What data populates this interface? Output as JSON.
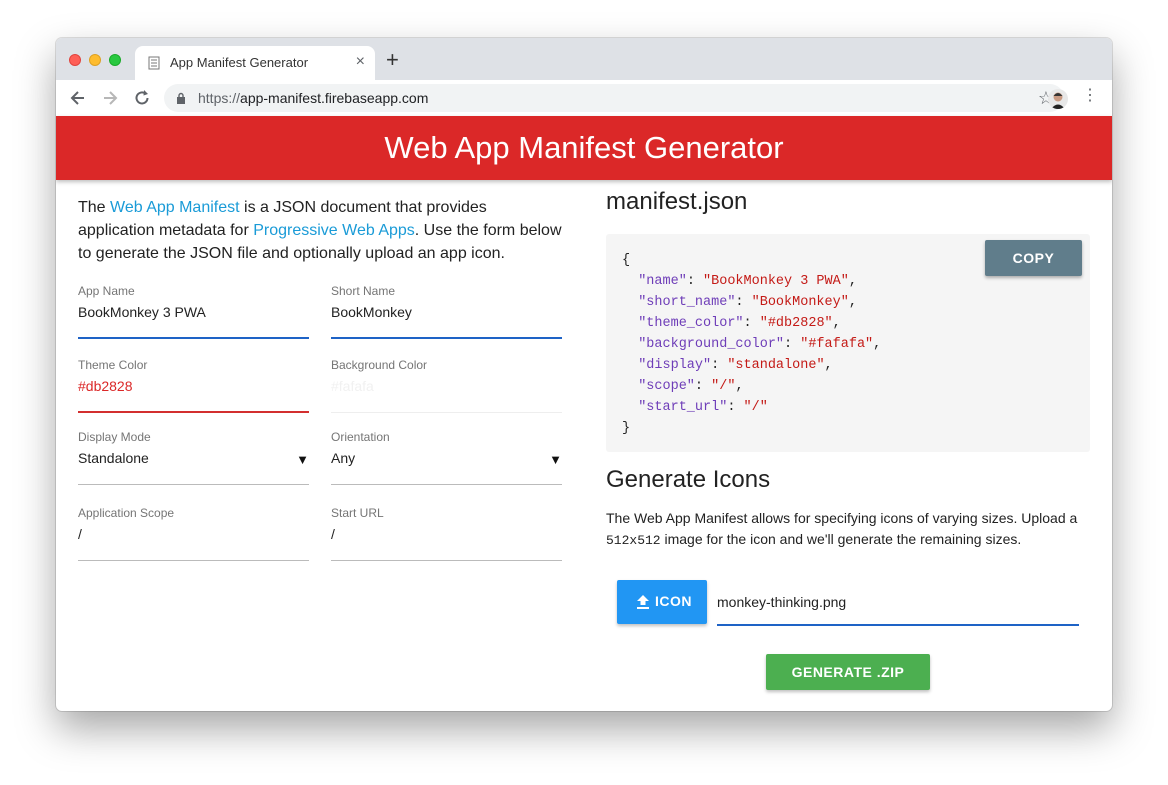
{
  "browser": {
    "tab_title": "App Manifest Generator",
    "tab_close": "×",
    "new_tab": "+",
    "url_scheme": "https://",
    "url_host": "app-manifest.firebaseapp.com"
  },
  "header": {
    "title": "Web App Manifest Generator"
  },
  "intro": {
    "t1": "The ",
    "link1": "Web App Manifest",
    "t2": " is a JSON document that provides application metadata for ",
    "link2": "Progressive Web Apps",
    "t3": ". Use the form below to generate the JSON file and optionally upload an app icon."
  },
  "form": {
    "app_name": {
      "label": "App Name",
      "value": "BookMonkey 3 PWA"
    },
    "short_name": {
      "label": "Short Name",
      "value": "BookMonkey"
    },
    "theme_color": {
      "label": "Theme Color",
      "value": "#db2828"
    },
    "background_color": {
      "label": "Background Color",
      "value": "#fafafa"
    },
    "display_mode": {
      "label": "Display Mode",
      "value": "Standalone"
    },
    "orientation": {
      "label": "Orientation",
      "value": "Any"
    },
    "scope": {
      "label": "Application Scope",
      "value": "/"
    },
    "start_url": {
      "label": "Start URL",
      "value": "/"
    }
  },
  "manifest": {
    "title": "manifest.json",
    "copy_label": "COPY",
    "entries": [
      {
        "key": "\"name\"",
        "value": "\"BookMonkey 3 PWA\""
      },
      {
        "key": "\"short_name\"",
        "value": "\"BookMonkey\""
      },
      {
        "key": "\"theme_color\"",
        "value": "\"#db2828\""
      },
      {
        "key": "\"background_color\"",
        "value": "\"#fafafa\""
      },
      {
        "key": "\"display\"",
        "value": "\"standalone\""
      },
      {
        "key": "\"scope\"",
        "value": "\"/\""
      },
      {
        "key": "\"start_url\"",
        "value": "\"/\""
      }
    ]
  },
  "icons": {
    "title": "Generate Icons",
    "desc1": "The Web App Manifest allows for specifying icons of varying sizes. Upload a ",
    "desc_code": "512x512",
    "desc2": " image for the icon and we'll generate the remaining sizes.",
    "icon_button": "ICON",
    "file_name": "monkey-thinking.png",
    "generate_button": "GENERATE .ZIP"
  },
  "colors": {
    "header_bg": "#db2828",
    "link": "#1a9bd7",
    "copy_button": "#607d8b",
    "icon_button": "#2196f3",
    "generate_button": "#4caf50"
  }
}
